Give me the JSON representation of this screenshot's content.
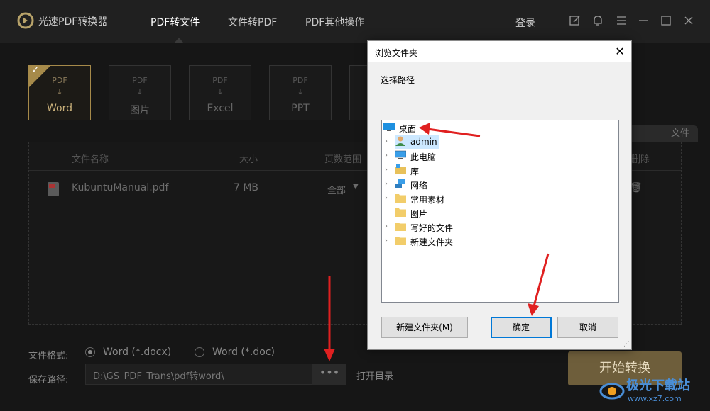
{
  "app": {
    "name": "光速PDF转换器",
    "nav": [
      "PDF转文件",
      "文件转PDF",
      "PDF其他操作"
    ],
    "login": "登录",
    "window_icons": [
      "edit-icon",
      "notification-icon",
      "menu-icon",
      "minimize-icon",
      "maximize-icon",
      "close-icon"
    ],
    "accent_color": "#a68a4a"
  },
  "modes": [
    {
      "src": "PDF",
      "dst": "Word",
      "selected": true
    },
    {
      "src": "PDF",
      "dst": "图片"
    },
    {
      "src": "PDF",
      "dst": "Excel"
    },
    {
      "src": "PDF",
      "dst": "PPT"
    }
  ],
  "file_table": {
    "add_tab": "文件",
    "headers": [
      "文件名称",
      "大小",
      "页数范围",
      "删除"
    ],
    "rows": [
      {
        "name": "KubuntuManual.pdf",
        "size": "7 MB",
        "range": "全部"
      }
    ]
  },
  "options": {
    "format_label": "文件格式:",
    "formats": [
      "Word (*.docx)",
      "Word (*.doc)"
    ],
    "save_label": "保存路径:",
    "save_path": "D:\\GS_PDF_Trans\\pdf转word\\",
    "dots": "•••",
    "open_dir": "打开目录",
    "start": "开始转换"
  },
  "dialog": {
    "title": "浏览文件夹",
    "prompt": "选择路径",
    "tree": [
      {
        "label": "桌面",
        "icon": "desktop-icon"
      },
      {
        "label": "admin",
        "icon": "user-icon",
        "highlight": true
      },
      {
        "label": "此电脑",
        "icon": "computer-icon"
      },
      {
        "label": "库",
        "icon": "library-icon"
      },
      {
        "label": "网络",
        "icon": "network-icon"
      },
      {
        "label": "常用素材",
        "icon": "folder-icon"
      },
      {
        "label": "图片",
        "icon": "folder-icon"
      },
      {
        "label": "写好的文件",
        "icon": "folder-icon"
      },
      {
        "label": "新建文件夹",
        "icon": "folder-icon"
      }
    ],
    "buttons": {
      "new_folder": "新建文件夹(M)",
      "ok": "确定",
      "cancel": "取消"
    },
    "close": "✕"
  },
  "watermark": {
    "title": "极光下载站",
    "url": "www.xz7.com"
  },
  "annotation_color": "#e02020"
}
